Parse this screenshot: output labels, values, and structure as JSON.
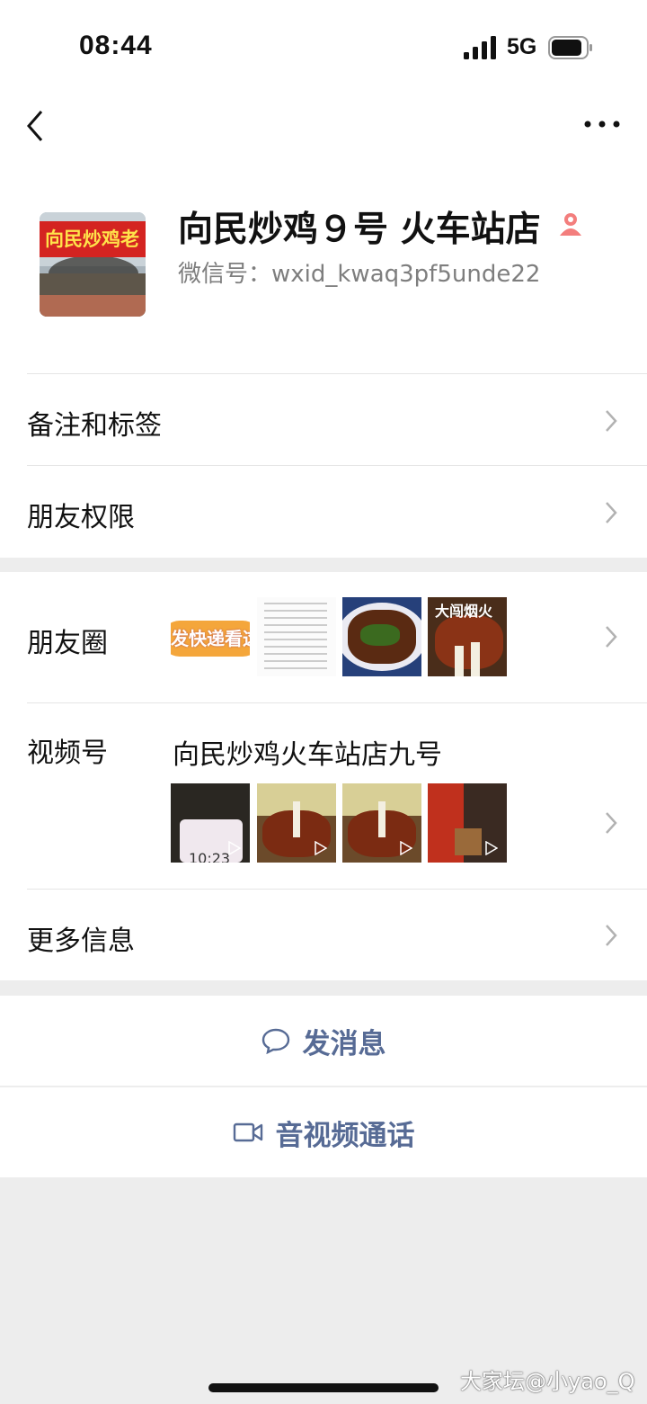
{
  "status_bar": {
    "time": "08:44",
    "network": "5G"
  },
  "profile": {
    "name": "向民炒鸡９号 火车站店",
    "wxid": "微信号：wxid_kwaq3pf5unde22",
    "avatar_sign_text": "向民炒鸡老",
    "gender": "female"
  },
  "menu": {
    "remarks_tags": "备注和标签",
    "friend_permissions": "朋友权限",
    "moments": "朋友圈",
    "channels": "视频号",
    "channels_name": "向民炒鸡火车站店九号",
    "more_info": "更多信息"
  },
  "moments_thumbs": [
    {
      "caption": "发快递看这"
    },
    {
      "caption": ""
    },
    {
      "caption": ""
    },
    {
      "caption": "大闯烟火"
    }
  ],
  "channel_thumbs": [
    {
      "caption": "10:23"
    },
    {
      "caption": ""
    },
    {
      "caption": ""
    },
    {
      "caption": ""
    }
  ],
  "actions": {
    "send_message": "发消息",
    "av_call": "音视频通话"
  },
  "watermark": "大家坛@小yao_Q",
  "colors": {
    "link_blue": "#576b95",
    "gender_female": "#f37e7d",
    "background": "#ededed"
  }
}
